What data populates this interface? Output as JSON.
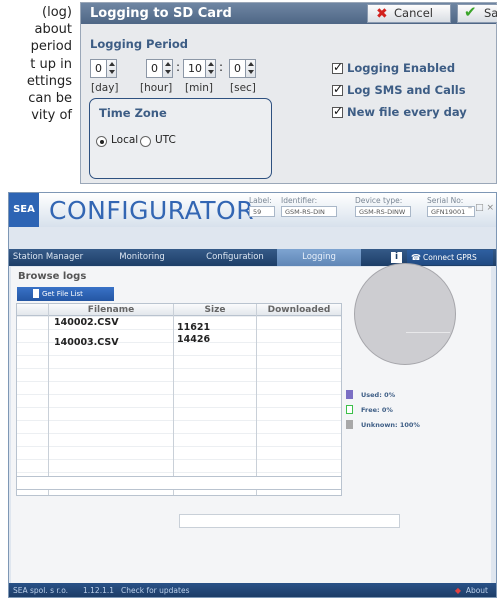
{
  "doc_fragment": {
    "lines": [
      "(log)",
      "about",
      "period",
      "t up in",
      "ettings",
      "can be",
      "vity of"
    ]
  },
  "dialog": {
    "title": "Logging to SD Card",
    "cancel_label": "Cancel",
    "save_label": "Save",
    "period_label": "Logging Period",
    "spinners": {
      "day": "0",
      "hour": "0",
      "min": "10",
      "sec": "0"
    },
    "units": {
      "day": "[day]",
      "hour": "[hour]",
      "min": "[min]",
      "sec": "[sec]"
    },
    "timezone": {
      "title": "Time Zone",
      "local": "Local",
      "utc": "UTC",
      "selected": "Local"
    },
    "checkboxes": [
      {
        "label": "Logging Enabled",
        "checked": true
      },
      {
        "label": "Log SMS and Calls",
        "checked": true
      },
      {
        "label": "New file every day",
        "checked": true
      }
    ],
    "colors": {
      "title_bar": "#5b7393",
      "label": "#3d5d85",
      "cancel_icon": "#d2221e",
      "save_icon": "#3aa52a"
    }
  },
  "app": {
    "logo_square": "SEA",
    "title": "CONFIGURATOR",
    "header_fields": [
      {
        "label": "Label:",
        "value": "59"
      },
      {
        "label": "Identifier:",
        "value": "GSM-RS-DIN"
      },
      {
        "label": "Device type:",
        "value": "GSM-RS-DINW"
      },
      {
        "label": "Serial No:",
        "value": "GFN19001"
      }
    ],
    "window_controls": "– □ ×",
    "tabs": [
      {
        "label": "Station Manager",
        "active": false
      },
      {
        "label": "Monitoring",
        "active": false
      },
      {
        "label": "Configuration",
        "active": false
      },
      {
        "label": "Logging",
        "active": true
      }
    ],
    "info_icon": "i",
    "gprs_button": "Connect GPRS",
    "section_title": "Browse logs",
    "get_file_list": "Get File List",
    "table": {
      "columns": [
        "Filename",
        "Size",
        "Downloaded"
      ],
      "rows": [
        {
          "filename": "140002.CSV",
          "size": "11621",
          "downloaded": ""
        },
        {
          "filename": "140003.CSV",
          "size": "14426",
          "downloaded": ""
        }
      ]
    },
    "legend": [
      {
        "label": "Used: 0%",
        "color": "#7b6fc4"
      },
      {
        "label": "Free: 0%",
        "color": "#3cc04a"
      },
      {
        "label": "Unknown: 100%",
        "color": "#a8a8a8"
      }
    ],
    "storage": {
      "used_percent": 0,
      "free_percent": 0,
      "unknown_percent": 100
    },
    "status_bar": {
      "company": "SEA spol. s r.o.",
      "version": "1.12.1.1",
      "updates": "Check for updates",
      "about": "About"
    }
  }
}
